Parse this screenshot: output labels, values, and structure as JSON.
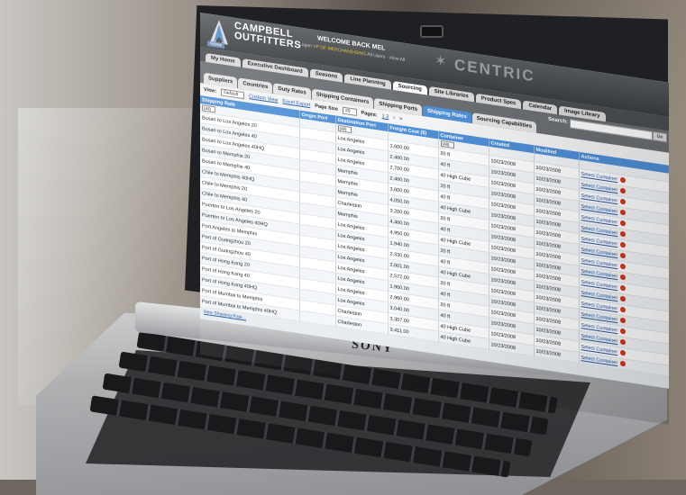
{
  "brand": {
    "line1": "CAMPBELL",
    "line2": "OUTFITTERS",
    "home_tag": "Home"
  },
  "header": {
    "welcome": "WELCOME BACK MEL",
    "user_prefix": "Logon",
    "user_highlight": "VP OF MERCHANDISING",
    "user_suffix": "All Users · View All",
    "partner": "CENTRIC"
  },
  "nav1": [
    "My Home",
    "Executive Dashboard",
    "Seasons",
    "Line Planning",
    "Sourcing",
    "Site Libraries",
    "Product Spec",
    "Calendar",
    "Image Library"
  ],
  "nav1_active": 4,
  "nav2": [
    "Suppliers",
    "Countries",
    "Duty Rates",
    "Shipping Containers",
    "Shipping Ports",
    "Shipping Rates",
    "Sourcing Capabilities"
  ],
  "nav2_active": 5,
  "search": {
    "label": "Search:",
    "button": "Go"
  },
  "toolbar": {
    "view_label": "View:",
    "view_value": "Default",
    "custom_view": "Custom View",
    "excel": "Excel Export",
    "page_size_label": "Page Size",
    "page_size_value": "20",
    "pages_label": "Pages:",
    "pages_value": "1 2"
  },
  "table": {
    "columns": [
      "Shipping Rate",
      "Origin Port",
      "Destination Port",
      "Freight Cost ($)",
      "Container",
      "Created",
      "Modified",
      "Actions"
    ],
    "filter_value": "(All)",
    "action_label": "Select Container",
    "rows": [
      [
        "Busan to Los Angeles 20",
        "",
        "Los Angeles",
        "1,600.00",
        "20 ft",
        "10/23/2008",
        "10/23/2008"
      ],
      [
        "Busan to Los Angeles 40",
        "",
        "Los Angeles",
        "2,400.00",
        "40 ft",
        "10/23/2008",
        "10/23/2008"
      ],
      [
        "Busan to Los Angeles 40HQ",
        "",
        "Los Angeles",
        "2,700.00",
        "40 High Cube",
        "10/23/2008",
        "10/23/2008"
      ],
      [
        "Busan to Memphis 20",
        "",
        "Memphis",
        "2,400.00",
        "20 ft",
        "10/23/2008",
        "10/23/2008"
      ],
      [
        "Busan to Memphis 40",
        "",
        "Memphis",
        "3,600.00",
        "40 ft",
        "10/23/2008",
        "10/23/2008"
      ],
      [
        "Chile to Memphis 40HQ",
        "",
        "Memphis",
        "4,050.00",
        "40 High Cube",
        "10/23/2008",
        "10/23/2008"
      ],
      [
        "Chile to Memphis 20",
        "",
        "Charleston",
        "3,200.00",
        "20 ft",
        "10/23/2008",
        "10/23/2008"
      ],
      [
        "Chile to Memphis 40",
        "",
        "Memphis",
        "4,400.00",
        "40 ft",
        "10/23/2008",
        "10/23/2008"
      ],
      [
        "Puerten to Los Angeles 20",
        "",
        "Los Angeles",
        "4,950.00",
        "40 High Cube",
        "10/23/2008",
        "10/23/2008"
      ],
      [
        "Puerten to Los Angeles 40HQ",
        "",
        "Los Angeles",
        "1,940.00",
        "20 ft",
        "10/23/2008",
        "10/23/2008"
      ],
      [
        "Port Angeles to Memphis",
        "",
        "Los Angeles",
        "2,330.00",
        "40 ft",
        "10/23/2008",
        "10/23/2008"
      ],
      [
        "Port of Guangzhou 20",
        "",
        "Los Angeles",
        "2,601.00",
        "40 High Cube",
        "10/23/2008",
        "10/23/2008"
      ],
      [
        "Port of Guangzhou 40",
        "",
        "Los Angeles",
        "2,572.00",
        "20 ft",
        "10/23/2008",
        "10/23/2008"
      ],
      [
        "Port of Hong Kong 20",
        "",
        "Los Angeles",
        "1,960.00",
        "40 ft",
        "10/23/2008",
        "10/23/2008"
      ],
      [
        "Port of Hong Kong 40",
        "",
        "Los Angeles",
        "2,960.00",
        "20 ft",
        "10/23/2008",
        "10/23/2008"
      ],
      [
        "Port of Hong Kong 40HQ",
        "",
        "Los Angeles",
        "3,040.00",
        "40 ft",
        "10/23/2008",
        "10/23/2008"
      ],
      [
        "Port of Mumbai to Memphis",
        "",
        "Charleston",
        "3,307.00",
        "40 High Cube",
        "10/23/2008",
        "10/23/2008"
      ],
      [
        "Port of Mumbai to Memphis 40HQ",
        "",
        "Charleston",
        "3,411.00",
        "40 High Cube",
        "10/23/2008",
        "10/23/2008"
      ]
    ],
    "footer_link": "New Shipping Rate..."
  },
  "laptop_brand": "SONY"
}
